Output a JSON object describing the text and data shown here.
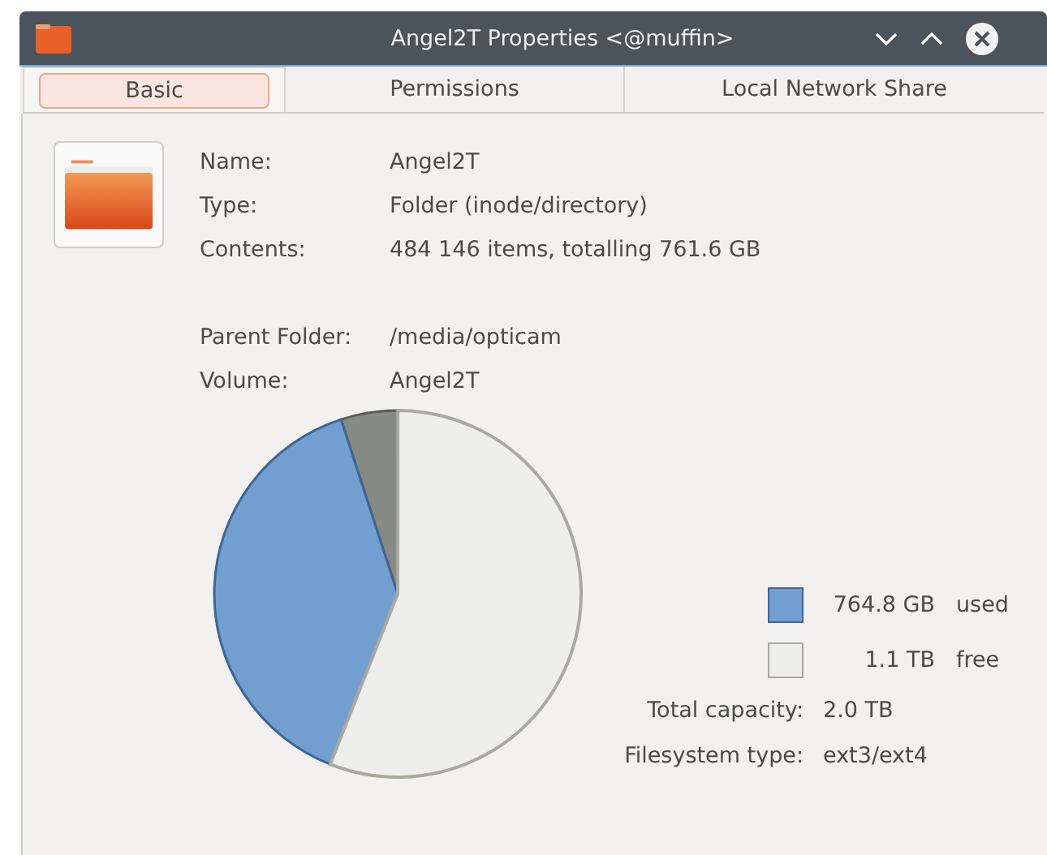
{
  "window": {
    "title": "Angel2T Properties <@muffin>"
  },
  "tabs": [
    {
      "label": "Basic",
      "selected": true
    },
    {
      "label": "Permissions",
      "selected": false
    },
    {
      "label": "Local Network Share",
      "selected": false
    }
  ],
  "info": [
    {
      "label": "Name:",
      "value": "Angel2T"
    },
    {
      "label": "Type:",
      "value": "Folder (inode/directory)"
    },
    {
      "label": "Contents:",
      "value": "484 146 items, totalling 761.6 GB"
    }
  ],
  "location": [
    {
      "label": "Parent Folder:",
      "value": "/media/opticam"
    },
    {
      "label": "Volume:",
      "value": "Angel2T"
    }
  ],
  "usage": [
    {
      "kind": "used",
      "value": "764.8 GB",
      "label": "used"
    },
    {
      "kind": "free",
      "value": "1.1 TB",
      "label": "free"
    }
  ],
  "details": [
    {
      "label": "Total capacity:",
      "value": "2.0 TB"
    },
    {
      "label": "Filesystem type:",
      "value": "ext3/ext4"
    }
  ]
}
